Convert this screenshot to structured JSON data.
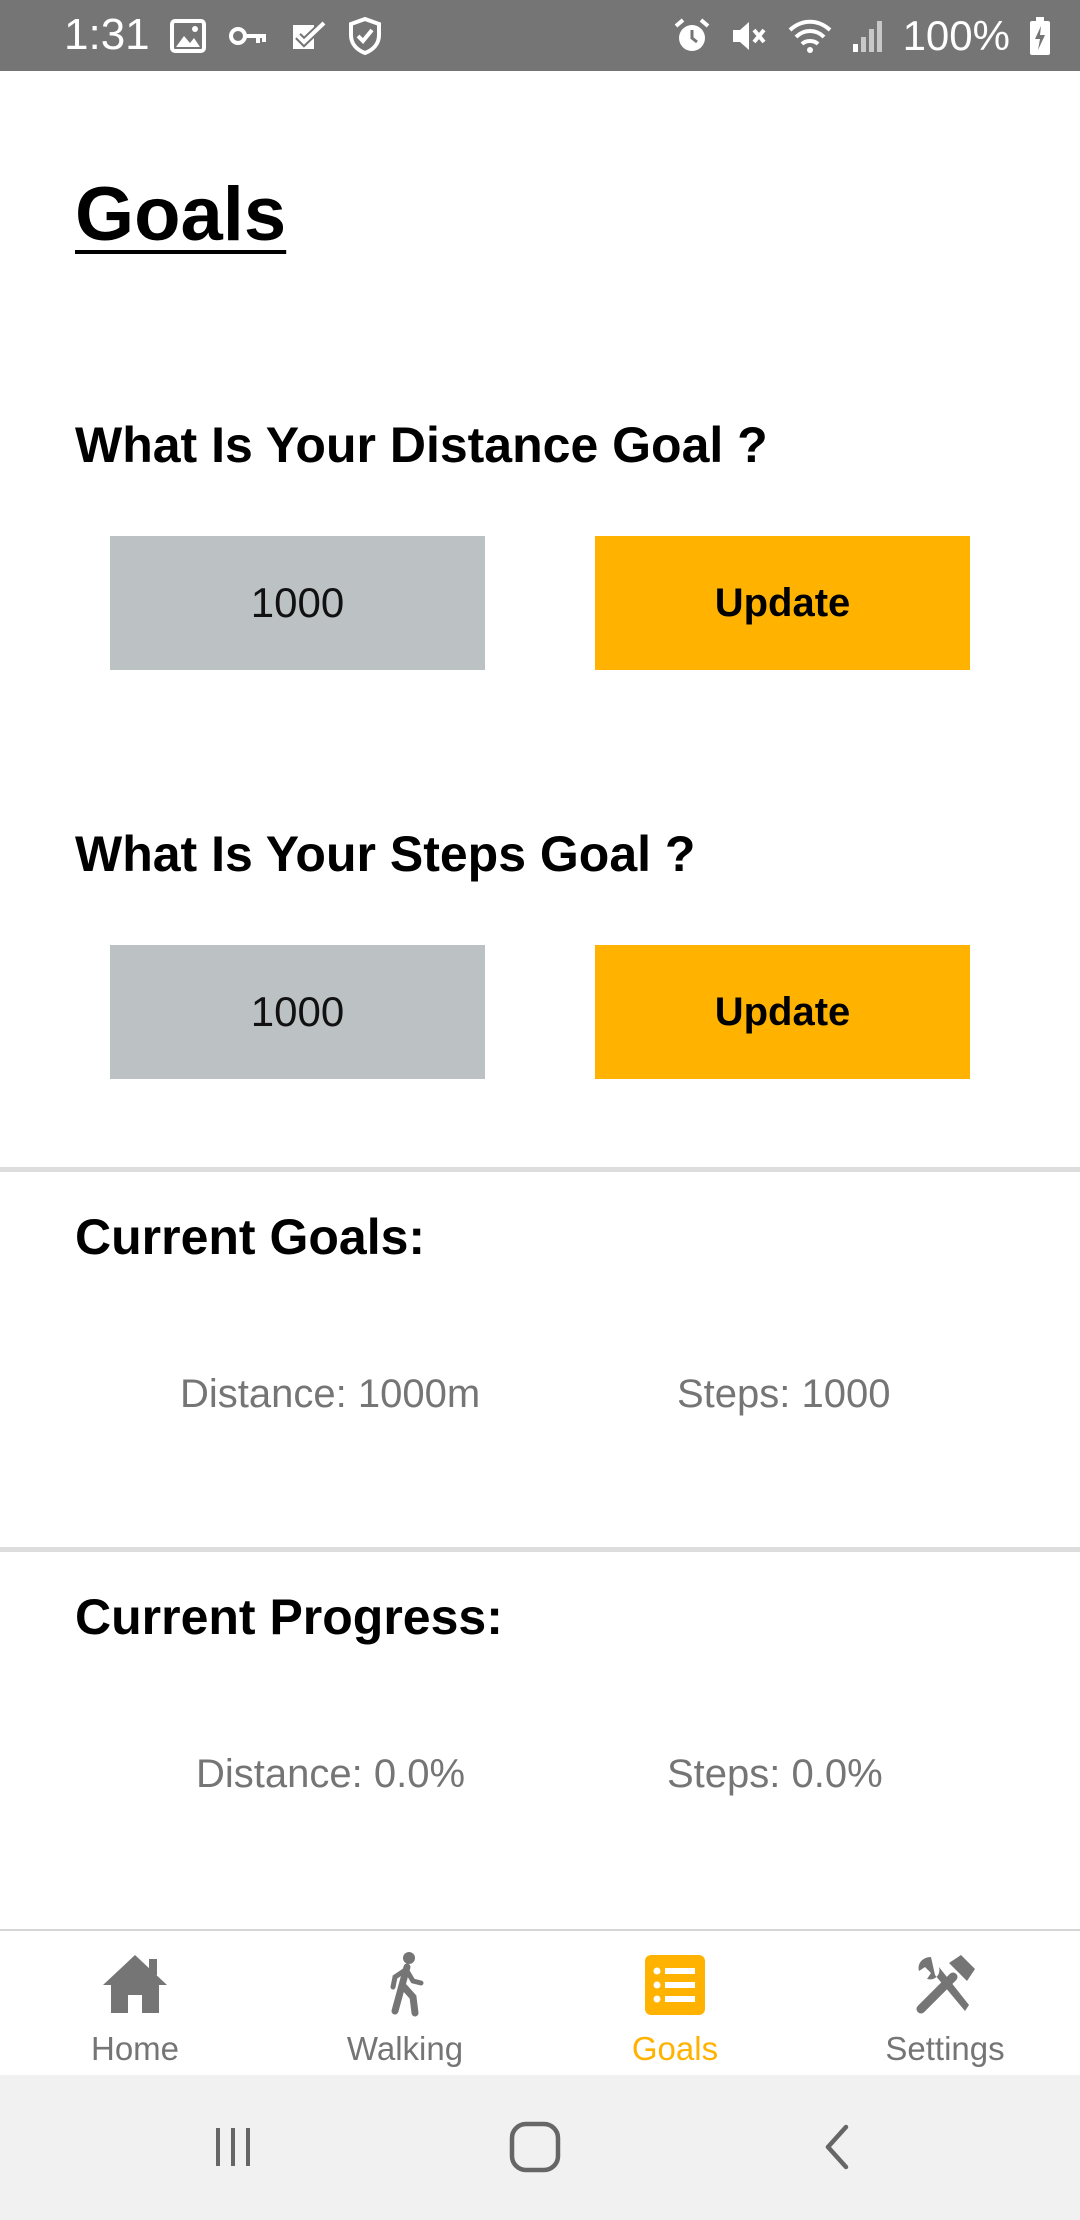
{
  "status_bar": {
    "time": "1:31",
    "battery_percent": "100%",
    "left_icons": [
      "gallery-icon",
      "key-icon",
      "task-check-icon",
      "shield-check-icon"
    ],
    "right_icons": [
      "alarm-icon",
      "mute-icon",
      "wifi-icon",
      "signal-icon",
      "battery-charging-icon"
    ]
  },
  "page": {
    "title": "Goals"
  },
  "distance_goal": {
    "question": "What Is Your Distance Goal ?",
    "input_value": "1000",
    "button_label": "Update"
  },
  "steps_goal": {
    "question": "What Is Your Steps Goal ?",
    "input_value": "1000",
    "button_label": "Update"
  },
  "current_goals": {
    "title": "Current Goals:",
    "distance": "Distance: 1000m",
    "steps": "Steps: 1000"
  },
  "current_progress": {
    "title": "Current Progress:",
    "distance": "Distance: 0.0%",
    "steps": "Steps: 0.0%"
  },
  "bottom_nav": {
    "active": "Goals",
    "items": [
      {
        "label": "Home",
        "icon": "home-icon"
      },
      {
        "label": "Walking",
        "icon": "walking-icon"
      },
      {
        "label": "Goals",
        "icon": "list-icon"
      },
      {
        "label": "Settings",
        "icon": "tools-icon"
      }
    ]
  },
  "colors": {
    "accent": "#ffb300",
    "input_bg": "#bcc1c4",
    "status_bar": "#757575",
    "muted_text": "#757575"
  }
}
